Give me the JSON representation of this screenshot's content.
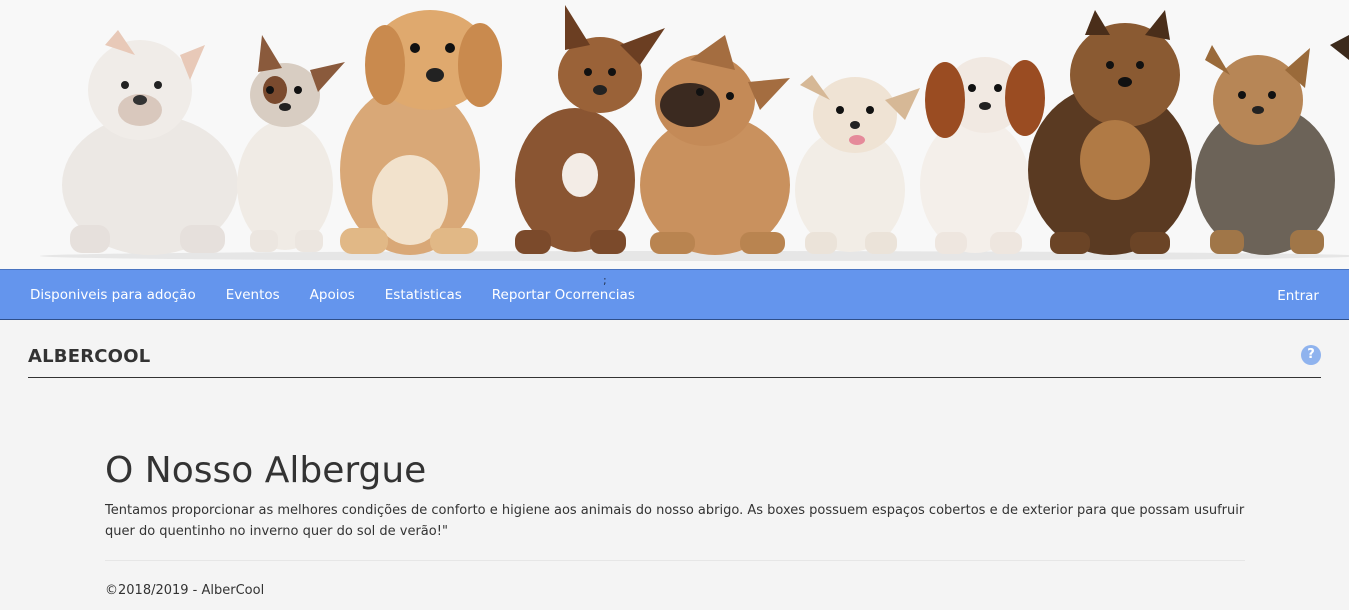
{
  "nav": {
    "items": [
      {
        "label": "Disponiveis para adoção"
      },
      {
        "label": "Eventos"
      },
      {
        "label": "Apoios"
      },
      {
        "label": "Estatisticas"
      },
      {
        "label": "Reportar Ocorrencias"
      }
    ],
    "stray_char": ";",
    "login_label": "Entrar"
  },
  "header": {
    "brand": "ALBERCOOL",
    "help_icon": "question-circle-icon"
  },
  "main": {
    "title": "O Nosso Albergue",
    "text": "Tentamos proporcionar as melhores condições de conforto e higiene aos animais do nosso abrigo. As boxes possuem espaços cobertos e de exterior para que possam usufruir quer do quentinho no inverno quer do sol de verão!\""
  },
  "footer": {
    "copyright": "©2018/2019 - AlberCool"
  },
  "colors": {
    "nav_background": "#6495ed",
    "page_background": "#f4f4f4",
    "help_icon": "#8fb3ee"
  }
}
